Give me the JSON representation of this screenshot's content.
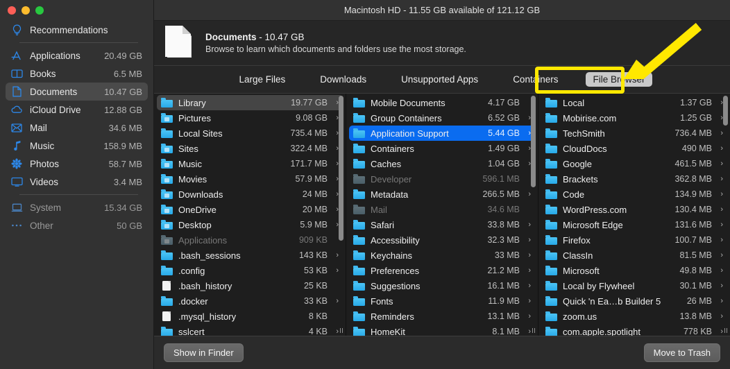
{
  "window": {
    "title": "Macintosh HD - 11.55 GB available of 121.12 GB",
    "accent_blue": "#0a6cf0",
    "folder_blue": "#27a9e8",
    "highlight_yellow": "#ffe800"
  },
  "sidebar": {
    "items": [
      {
        "label": "Recommendations",
        "size": "",
        "icon": "lightbulb-icon",
        "state": "normal"
      },
      {
        "label": "Applications",
        "size": "20.49 GB",
        "icon": "appstore-icon",
        "state": "normal"
      },
      {
        "label": "Books",
        "size": "6.5 MB",
        "icon": "book-icon",
        "state": "normal"
      },
      {
        "label": "Documents",
        "size": "10.47 GB",
        "icon": "document-icon",
        "state": "selected"
      },
      {
        "label": "iCloud Drive",
        "size": "12.88 GB",
        "icon": "cloud-icon",
        "state": "normal"
      },
      {
        "label": "Mail",
        "size": "34.6 MB",
        "icon": "envelope-icon",
        "state": "normal"
      },
      {
        "label": "Music",
        "size": "158.9 MB",
        "icon": "music-note-icon",
        "state": "normal"
      },
      {
        "label": "Photos",
        "size": "58.7 MB",
        "icon": "photos-flower-icon",
        "state": "normal"
      },
      {
        "label": "Videos",
        "size": "3.4 MB",
        "icon": "monitor-icon",
        "state": "normal"
      },
      {
        "label": "System",
        "size": "15.34 GB",
        "icon": "laptop-icon",
        "state": "dim"
      },
      {
        "label": "Other",
        "size": "50 GB",
        "icon": "ellipsis-icon",
        "state": "dim"
      }
    ]
  },
  "header": {
    "icon": "document-page-icon",
    "title_name": "Documents",
    "title_size": " - 10.47 GB",
    "subtitle": "Browse to learn which documents and folders use the most storage."
  },
  "tabs": [
    {
      "label": "Large Files",
      "active": false
    },
    {
      "label": "Downloads",
      "active": false
    },
    {
      "label": "Unsupported Apps",
      "active": false
    },
    {
      "label": "Containers",
      "active": false
    },
    {
      "label": "File Browser",
      "active": true
    }
  ],
  "columns": [
    {
      "name": "column-1",
      "scroll_thumb_pct": 63,
      "scroll_offset_pct": 0,
      "rows": [
        {
          "name": "Library",
          "size": "19.77 GB",
          "icon": "folder-icon",
          "chevron": true,
          "state": "selected-gray"
        },
        {
          "name": "Pictures",
          "size": "9.08 GB",
          "icon": "folder-pictures-icon",
          "chevron": true,
          "state": "normal"
        },
        {
          "name": "Local Sites",
          "size": "735.4 MB",
          "icon": "folder-icon",
          "chevron": true,
          "state": "normal"
        },
        {
          "name": "Sites",
          "size": "322.4 MB",
          "icon": "folder-sites-icon",
          "chevron": true,
          "state": "normal"
        },
        {
          "name": "Music",
          "size": "171.7 MB",
          "icon": "folder-music-icon",
          "chevron": true,
          "state": "normal"
        },
        {
          "name": "Movies",
          "size": "57.9 MB",
          "icon": "folder-movies-icon",
          "chevron": true,
          "state": "normal"
        },
        {
          "name": "Downloads",
          "size": "24 MB",
          "icon": "folder-downloads-icon",
          "chevron": true,
          "state": "normal"
        },
        {
          "name": "OneDrive",
          "size": "20 MB",
          "icon": "folder-onedrive-icon",
          "chevron": true,
          "state": "normal"
        },
        {
          "name": "Desktop",
          "size": "5.9 MB",
          "icon": "folder-desktop-icon",
          "chevron": true,
          "state": "normal"
        },
        {
          "name": "Applications",
          "size": "909 KB",
          "icon": "folder-applications-icon",
          "chevron": false,
          "state": "dim"
        },
        {
          "name": ".bash_sessions",
          "size": "143 KB",
          "icon": "folder-icon",
          "chevron": true,
          "state": "normal"
        },
        {
          "name": ".config",
          "size": "53 KB",
          "icon": "folder-icon",
          "chevron": true,
          "state": "normal"
        },
        {
          "name": ".bash_history",
          "size": "25 KB",
          "icon": "file-icon",
          "chevron": false,
          "state": "normal"
        },
        {
          "name": ".docker",
          "size": "33 KB",
          "icon": "folder-icon",
          "chevron": true,
          "state": "normal"
        },
        {
          "name": ".mysql_history",
          "size": "8 KB",
          "icon": "file-icon",
          "chevron": false,
          "state": "normal"
        },
        {
          "name": "sslcert",
          "size": "4 KB",
          "icon": "folder-icon",
          "chevron": true,
          "state": "normal"
        }
      ]
    },
    {
      "name": "column-2",
      "scroll_thumb_pct": 40,
      "scroll_offset_pct": 0,
      "rows": [
        {
          "name": "Mobile Documents",
          "size": "4.17 GB",
          "icon": "folder-icon",
          "chevron": false,
          "state": "normal"
        },
        {
          "name": "Group Containers",
          "size": "6.52 GB",
          "icon": "folder-icon",
          "chevron": true,
          "state": "normal"
        },
        {
          "name": "Application Support",
          "size": "5.44 GB",
          "icon": "folder-icon",
          "chevron": true,
          "state": "selected-blue"
        },
        {
          "name": "Containers",
          "size": "1.49 GB",
          "icon": "folder-icon",
          "chevron": true,
          "state": "normal"
        },
        {
          "name": "Caches",
          "size": "1.04 GB",
          "icon": "folder-icon",
          "chevron": true,
          "state": "normal"
        },
        {
          "name": "Developer",
          "size": "596.1 MB",
          "icon": "folder-icon",
          "chevron": false,
          "state": "dim"
        },
        {
          "name": "Metadata",
          "size": "266.5 MB",
          "icon": "folder-icon",
          "chevron": true,
          "state": "normal"
        },
        {
          "name": "Mail",
          "size": "34.6 MB",
          "icon": "folder-icon",
          "chevron": false,
          "state": "dim"
        },
        {
          "name": "Safari",
          "size": "33.8 MB",
          "icon": "folder-icon",
          "chevron": true,
          "state": "normal"
        },
        {
          "name": "Accessibility",
          "size": "32.3 MB",
          "icon": "folder-icon",
          "chevron": true,
          "state": "normal"
        },
        {
          "name": "Keychains",
          "size": "33 MB",
          "icon": "folder-icon",
          "chevron": true,
          "state": "normal"
        },
        {
          "name": "Preferences",
          "size": "21.2 MB",
          "icon": "folder-icon",
          "chevron": true,
          "state": "normal"
        },
        {
          "name": "Suggestions",
          "size": "16.1 MB",
          "icon": "folder-icon",
          "chevron": true,
          "state": "normal"
        },
        {
          "name": "Fonts",
          "size": "11.9 MB",
          "icon": "folder-icon",
          "chevron": true,
          "state": "normal"
        },
        {
          "name": "Reminders",
          "size": "13.1 MB",
          "icon": "folder-icon",
          "chevron": true,
          "state": "normal"
        },
        {
          "name": "HomeKit",
          "size": "8.1 MB",
          "icon": "folder-icon",
          "chevron": true,
          "state": "normal"
        }
      ]
    },
    {
      "name": "column-3",
      "scroll_thumb_pct": 13,
      "scroll_offset_pct": 0,
      "rows": [
        {
          "name": "Local",
          "size": "1.37 GB",
          "icon": "folder-icon",
          "chevron": true,
          "state": "normal"
        },
        {
          "name": "Mobirise.com",
          "size": "1.25 GB",
          "icon": "folder-icon",
          "chevron": true,
          "state": "normal"
        },
        {
          "name": "TechSmith",
          "size": "736.4 MB",
          "icon": "folder-icon",
          "chevron": true,
          "state": "normal"
        },
        {
          "name": "CloudDocs",
          "size": "490 MB",
          "icon": "folder-icon",
          "chevron": true,
          "state": "normal"
        },
        {
          "name": "Google",
          "size": "461.5 MB",
          "icon": "folder-icon",
          "chevron": true,
          "state": "normal"
        },
        {
          "name": "Brackets",
          "size": "362.8 MB",
          "icon": "folder-icon",
          "chevron": true,
          "state": "normal"
        },
        {
          "name": "Code",
          "size": "134.9 MB",
          "icon": "folder-icon",
          "chevron": true,
          "state": "normal"
        },
        {
          "name": "WordPress.com",
          "size": "130.4 MB",
          "icon": "folder-icon",
          "chevron": true,
          "state": "normal"
        },
        {
          "name": "Microsoft Edge",
          "size": "131.6 MB",
          "icon": "folder-icon",
          "chevron": true,
          "state": "normal"
        },
        {
          "name": "Firefox",
          "size": "100.7 MB",
          "icon": "folder-icon",
          "chevron": true,
          "state": "normal"
        },
        {
          "name": "ClassIn",
          "size": "81.5 MB",
          "icon": "folder-icon",
          "chevron": true,
          "state": "normal"
        },
        {
          "name": "Microsoft",
          "size": "49.8 MB",
          "icon": "folder-icon",
          "chevron": true,
          "state": "normal"
        },
        {
          "name": "Local by Flywheel",
          "size": "30.1 MB",
          "icon": "folder-icon",
          "chevron": true,
          "state": "normal"
        },
        {
          "name": "Quick 'n Ea…b Builder 5",
          "size": "26 MB",
          "icon": "folder-icon",
          "chevron": true,
          "state": "normal"
        },
        {
          "name": "zoom.us",
          "size": "13.8 MB",
          "icon": "folder-icon",
          "chevron": true,
          "state": "normal"
        },
        {
          "name": "com.apple.spotlight",
          "size": "778 KB",
          "icon": "folder-icon",
          "chevron": true,
          "state": "normal"
        }
      ]
    }
  ],
  "footer": {
    "show_in_finder": "Show in Finder",
    "move_to_trash": "Move to Trash"
  },
  "annotations": {
    "highlight_target": "File Browser",
    "arrow": "yellow-arrow-pointing-to-file-browser"
  }
}
